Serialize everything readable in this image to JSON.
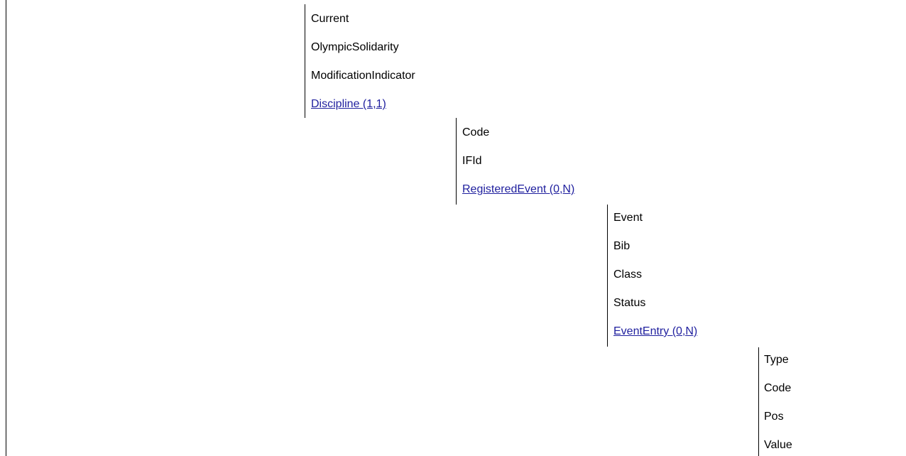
{
  "level1": {
    "items": [
      "Current",
      "OlympicSolidarity",
      "ModificationIndicator"
    ],
    "link": "Discipline (1,1)"
  },
  "level2": {
    "items": [
      "Code",
      "IFId"
    ],
    "link": "RegisteredEvent (0,N)"
  },
  "level3": {
    "items": [
      "Event",
      "Bib",
      "Class",
      "Status"
    ],
    "link": "EventEntry (0,N)"
  },
  "level4": {
    "items": [
      "Type",
      "Code",
      "Pos",
      "Value"
    ]
  },
  "colors": {
    "link": "#1f1f9e",
    "text": "#000000",
    "rule": "#000000"
  }
}
